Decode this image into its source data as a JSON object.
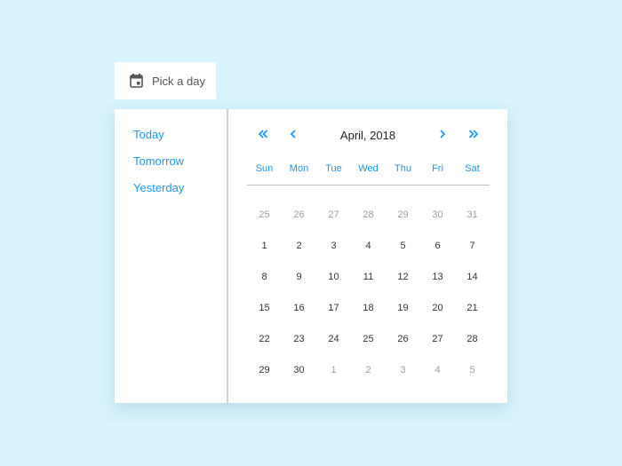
{
  "trigger": {
    "icon": "calendar-icon",
    "label": "Pick a day"
  },
  "shortcuts": [
    {
      "label": "Today"
    },
    {
      "label": "Tomorrow"
    },
    {
      "label": "Yesterday"
    }
  ],
  "calendar": {
    "title": "April, 2018",
    "nav": {
      "prev_year_icon": "double-chevron-left-icon",
      "prev_month_icon": "chevron-left-icon",
      "next_month_icon": "chevron-right-icon",
      "next_year_icon": "double-chevron-right-icon"
    },
    "accent_color": "#2196f3",
    "weekdays": [
      "Sun",
      "Mon",
      "Tue",
      "Wed",
      "Thu",
      "Fri",
      "Sat"
    ],
    "weeks": [
      [
        {
          "d": "25",
          "out": true
        },
        {
          "d": "26",
          "out": true
        },
        {
          "d": "27",
          "out": true
        },
        {
          "d": "28",
          "out": true
        },
        {
          "d": "29",
          "out": true
        },
        {
          "d": "30",
          "out": true
        },
        {
          "d": "31",
          "out": true
        }
      ],
      [
        {
          "d": "1"
        },
        {
          "d": "2"
        },
        {
          "d": "3"
        },
        {
          "d": "4"
        },
        {
          "d": "5"
        },
        {
          "d": "6"
        },
        {
          "d": "7"
        }
      ],
      [
        {
          "d": "8"
        },
        {
          "d": "9"
        },
        {
          "d": "10"
        },
        {
          "d": "11"
        },
        {
          "d": "12"
        },
        {
          "d": "13"
        },
        {
          "d": "14"
        }
      ],
      [
        {
          "d": "15"
        },
        {
          "d": "16"
        },
        {
          "d": "17"
        },
        {
          "d": "18"
        },
        {
          "d": "19"
        },
        {
          "d": "20"
        },
        {
          "d": "21"
        }
      ],
      [
        {
          "d": "22"
        },
        {
          "d": "23"
        },
        {
          "d": "24"
        },
        {
          "d": "25"
        },
        {
          "d": "26"
        },
        {
          "d": "27"
        },
        {
          "d": "28"
        }
      ],
      [
        {
          "d": "29"
        },
        {
          "d": "30"
        },
        {
          "d": "1",
          "out": true
        },
        {
          "d": "2",
          "out": true
        },
        {
          "d": "3",
          "out": true
        },
        {
          "d": "4",
          "out": true
        },
        {
          "d": "5",
          "out": true
        }
      ]
    ]
  }
}
